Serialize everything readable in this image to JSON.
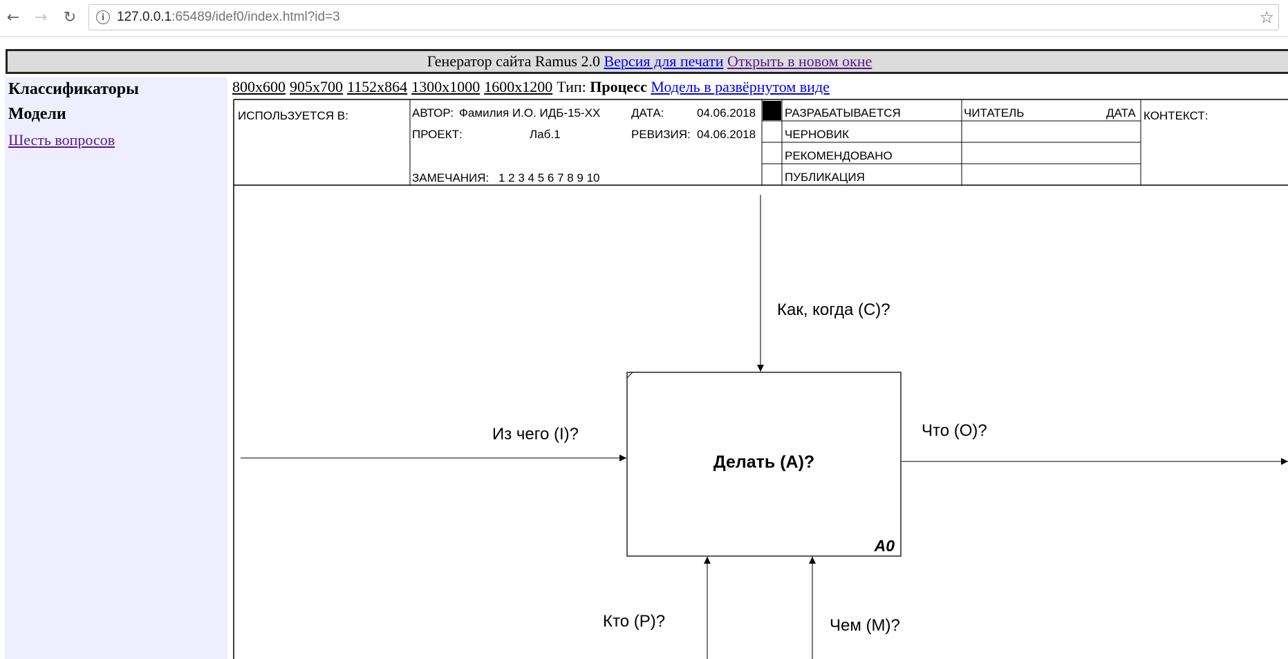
{
  "browser": {
    "back_icon": "arrow-left-icon",
    "forward_icon": "arrow-right-icon",
    "reload_icon": "reload-icon",
    "url_host": "127.0.0.1",
    "url_rest": ":65489/idef0/index.html?id=3",
    "bookmark_icon": "star-icon"
  },
  "header": {
    "prefix": "Генератор сайта Ramus 2.0",
    "print_link": "Версия для печати",
    "new_window_link": "Открыть в новом окне"
  },
  "sidebar": {
    "classifiers": "Классификаторы",
    "models": "Модели",
    "six_questions": "Шесть вопросов"
  },
  "toolbar": {
    "sizes": [
      "800x600",
      "905x700",
      "1152x864",
      "1300x1000",
      "1600x1200"
    ],
    "type_label": "Тип:",
    "type_value": "Процесс",
    "expanded_link": "Модель в развёрнутом виде "
  },
  "frame": {
    "used_in": "ИСПОЛЬЗУЕТСЯ В:",
    "author_label": "АВТОР:",
    "author_value": "Фамилия И.О. ИДБ-15-ХХ",
    "project_label": "ПРОЕКТ:",
    "project_value": "Лаб.1",
    "notes_label": "ЗАМЕЧАНИЯ:",
    "notes_value": "1  2  3  4  5  6  7  8  9  10",
    "date_label": "ДАТА:",
    "date_value": "04.06.2018",
    "revision_label": "РЕВИЗИЯ:",
    "revision_value": "04.06.2018",
    "status": [
      "РАЗРАБАТЫВАЕТСЯ",
      "ЧЕРНОВИК",
      "РЕКОМЕНДОВАНО",
      "ПУБЛИКАЦИЯ"
    ],
    "reader_label": "ЧИТАТЕЛЬ",
    "reader_date_label": "ДАТА",
    "context_label": "КОНТЕКСТ:"
  },
  "diagram": {
    "activity": "Делать (А)?",
    "node": "А0",
    "control": "Как, когда (С)?",
    "input": "Из чего (I)?",
    "output": "Что (О)?",
    "mechanism_who": "Кто (Р)?",
    "mechanism_with": "Чем (М)?"
  }
}
